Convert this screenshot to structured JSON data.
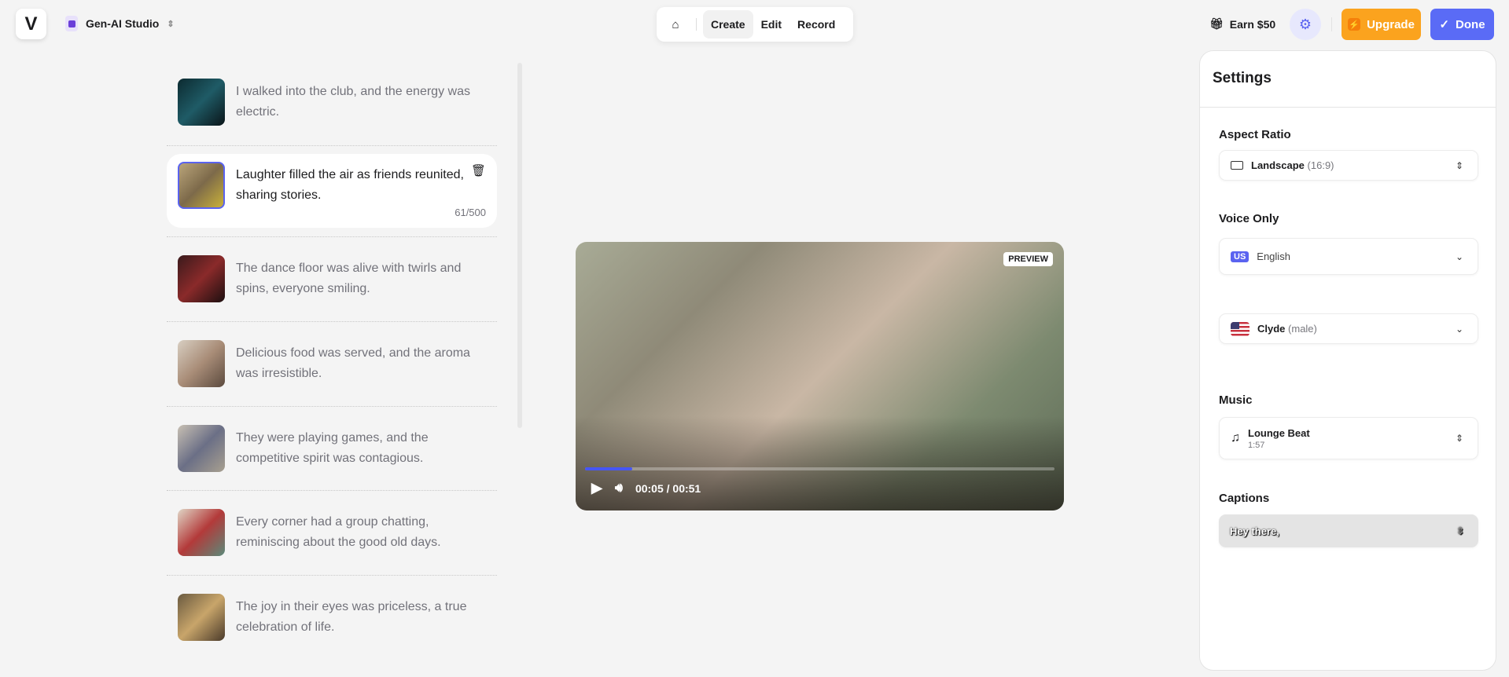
{
  "header": {
    "logo": "V",
    "studio": "Gen-AI Studio",
    "nav": {
      "create": "Create",
      "edit": "Edit",
      "record": "Record"
    },
    "earn": "Earn $50",
    "upgrade": "Upgrade",
    "done": "Done"
  },
  "scenes": [
    {
      "text": "I walked into the club, and the energy was electric.",
      "thumb": "linear-gradient(135deg,#0c2a30,#1f5b66,#0a1418)"
    },
    {
      "text": "Laughter filled the air as friends reunited, sharing stories.",
      "counter": "61/500",
      "thumb": "linear-gradient(135deg,#b9a47a,#7d6a4a,#c9b13a)"
    },
    {
      "text": "The dance floor was alive with twirls and spins, everyone smiling.",
      "thumb": "linear-gradient(135deg,#3a1a1c,#8a2a2a,#1c0f10)"
    },
    {
      "text": "Delicious food was served, and the aroma was irresistible.",
      "thumb": "linear-gradient(135deg,#d8cfc2,#a98d78,#5b4a3e)"
    },
    {
      "text": "They were playing games, and the competitive spirit was contagious.",
      "thumb": "linear-gradient(135deg,#c8c0b3,#6b6f86,#a8a090)"
    },
    {
      "text": "Every corner had a group chatting, reminiscing about the good old days.",
      "thumb": "linear-gradient(135deg,#e0d6c6,#b33a3a,#5a8a7a)"
    },
    {
      "text": "The joy in their eyes was priceless, a true celebration of life.",
      "thumb": "linear-gradient(135deg,#6a5a40,#c8a56a,#4a3a2a)"
    }
  ],
  "player": {
    "badge": "PREVIEW",
    "time": "00:05 / 00:51",
    "progress": 0.1
  },
  "settings": {
    "title": "Settings",
    "aspect_label": "Aspect Ratio",
    "aspect": "Landscape",
    "aspect_ratio": "(16:9)",
    "voice_label": "Voice Only",
    "lang_badge": "US",
    "language": "English",
    "voice": "Clyde",
    "voice_gender": "(male)",
    "music_label": "Music",
    "music": "Lounge Beat",
    "music_duration": "1:57",
    "captions_label": "Captions",
    "caption_style": "Hey there,"
  }
}
